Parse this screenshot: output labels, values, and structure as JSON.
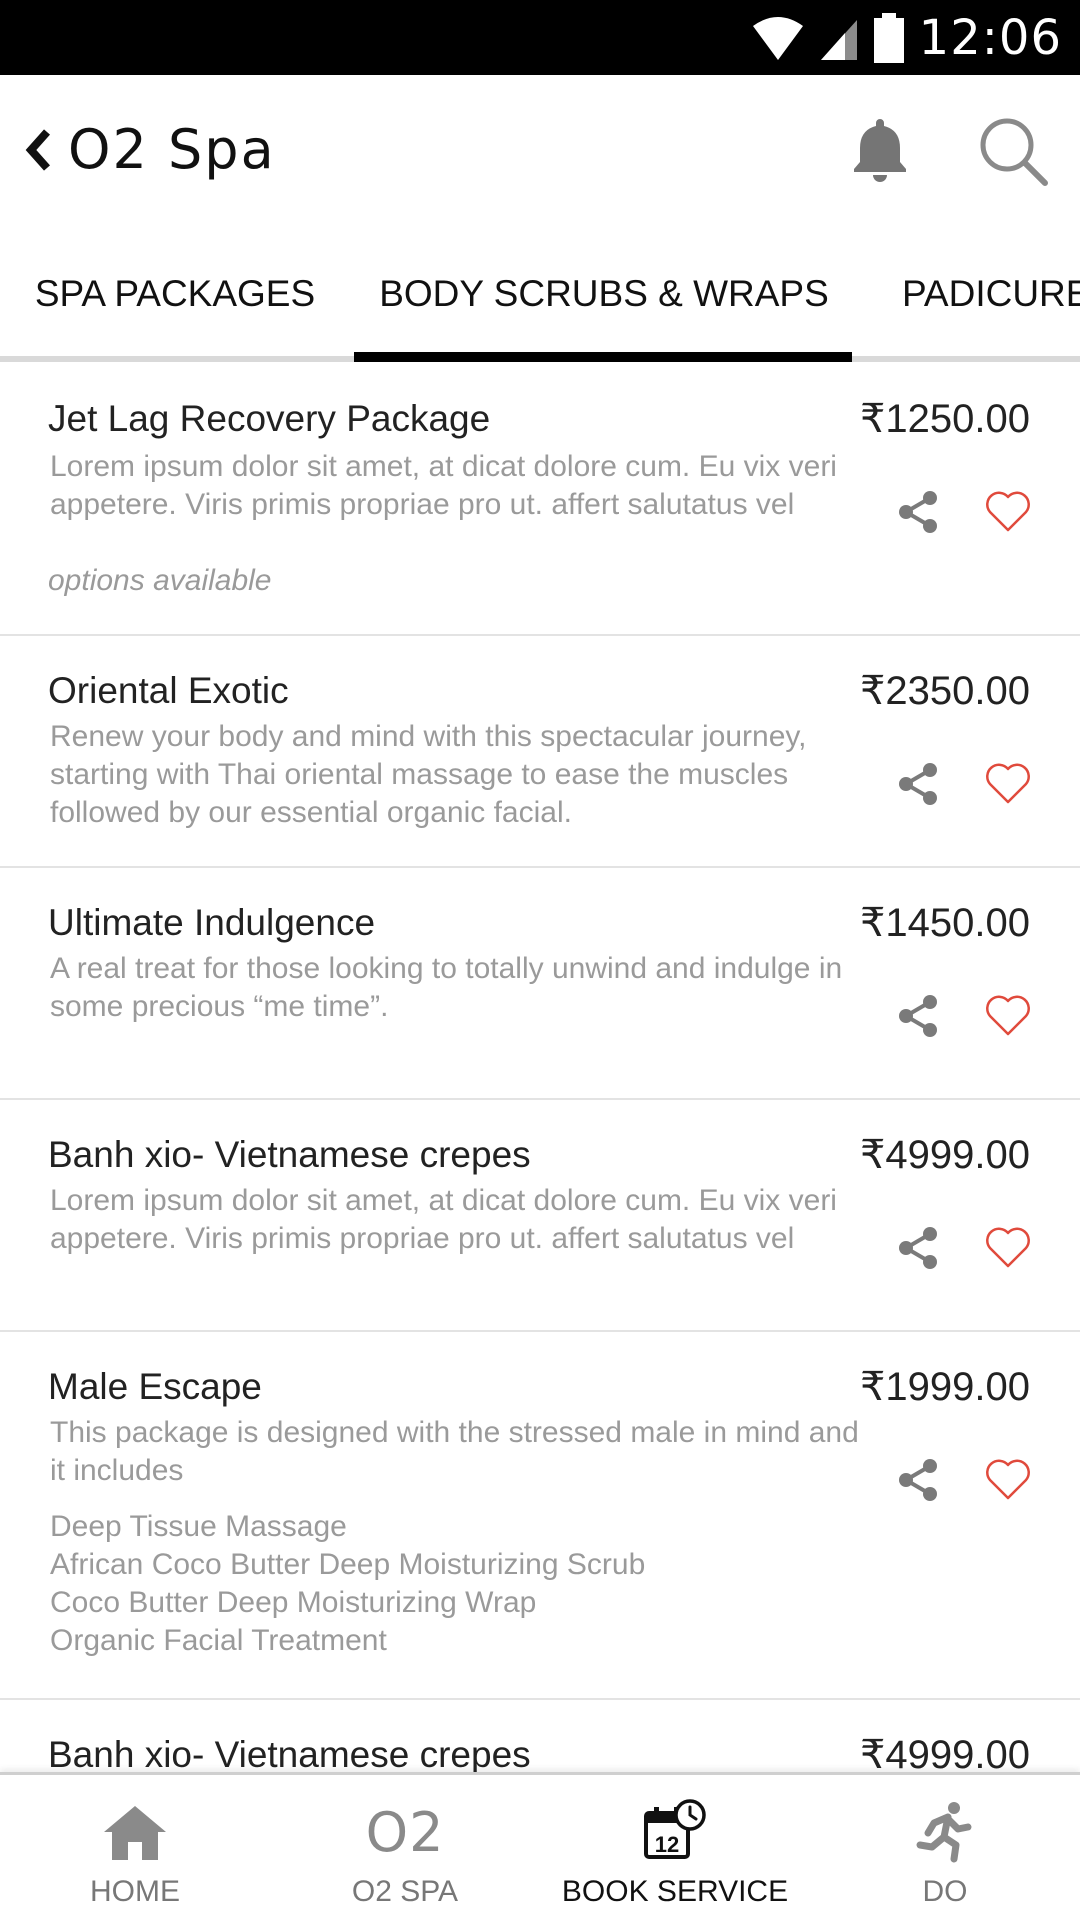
{
  "status_bar": {
    "time": "12:06"
  },
  "header": {
    "title": "O2 Spa"
  },
  "tabs": [
    {
      "label": "SPA PACKAGES"
    },
    {
      "label": "BODY SCRUBS & WRAPS"
    },
    {
      "label": "PADICURE"
    }
  ],
  "active_tab": "BODY SCRUBS & WRAPS",
  "items": [
    {
      "name": "Jet Lag Recovery Package",
      "price": "₹1250.00",
      "description": "Lorem ipsum dolor sit amet, at dicat dolore cum. Eu vix veri appetere. Viris primis propriae pro ut. affert salutatus vel",
      "note": "options available"
    },
    {
      "name": "Oriental Exotic",
      "price": "₹2350.00",
      "description": "Renew your body and mind with this spectacular journey, starting with Thai oriental massage to ease the muscles followed by our essential organic facial."
    },
    {
      "name": "Ultimate Indulgence",
      "price": "₹1450.00",
      "description": "A real treat for those looking to totally unwind and indulge in some precious “me time”."
    },
    {
      "name": "Banh xio- Vietnamese crepes",
      "price": "₹4999.00",
      "description": "Lorem ipsum dolor sit amet, at dicat dolore cum. Eu vix veri appetere. Viris primis propriae pro ut. affert salutatus vel"
    },
    {
      "name": "Male Escape",
      "price": "₹1999.00",
      "description": "This package is designed with the stressed male in mind and it includes",
      "includes": [
        "Deep Tissue Massage",
        "African Coco Butter Deep Moisturizing Scrub",
        "Coco Butter Deep Moisturizing Wrap",
        "Organic Facial Treatment"
      ]
    },
    {
      "name": "Banh xio- Vietnamese crepes",
      "price": "₹4999.00"
    }
  ],
  "bottom_nav": [
    {
      "label": "HOME",
      "icon": "home-icon"
    },
    {
      "label": "O2 SPA",
      "icon_text": "O2"
    },
    {
      "label": "BOOK SERVICE",
      "icon": "calendar-clock-icon",
      "calendar_day": "12"
    },
    {
      "label": "DO",
      "icon": "running-person-icon"
    }
  ],
  "colors": {
    "heart": "#e04a3c",
    "text_dark": "#222222",
    "text_muted": "#9a9a9a",
    "status_bar": "#000000"
  }
}
